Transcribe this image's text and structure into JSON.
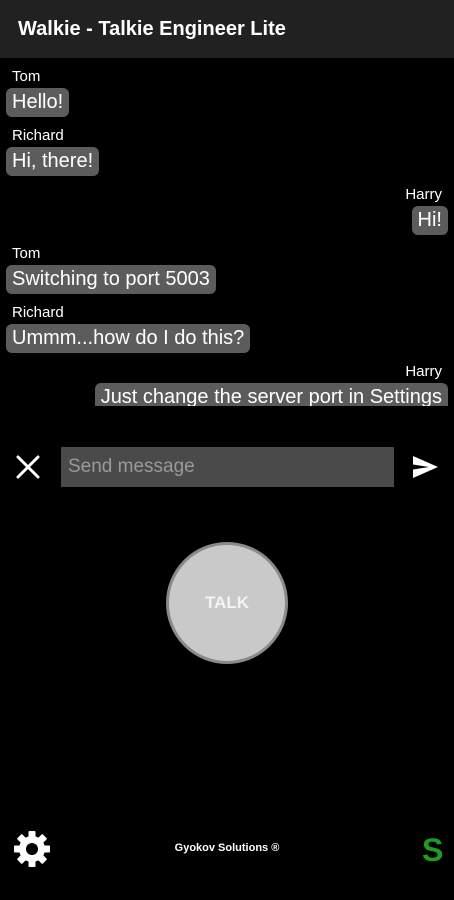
{
  "app": {
    "title": "Walkie - Talkie Engineer Lite"
  },
  "messages": [
    {
      "sender": "Tom",
      "text": "Hello!",
      "side": "left"
    },
    {
      "sender": "Richard",
      "text": "Hi, there!",
      "side": "left"
    },
    {
      "sender": "Harry",
      "text": "Hi!",
      "side": "right"
    },
    {
      "sender": "Tom",
      "text": "Switching to port 5003",
      "side": "left"
    },
    {
      "sender": "Richard",
      "text": "Ummm...how do I do this?",
      "side": "left"
    },
    {
      "sender": "Harry",
      "text": "Just change the server port in Settings",
      "side": "right"
    }
  ],
  "input": {
    "placeholder": "Send message",
    "value": ""
  },
  "talk": {
    "label": "TALK"
  },
  "footer": {
    "brand": "Gyokov Solutions ®",
    "status_letter": "S",
    "status_color": "#1e9e1e"
  },
  "icons": {
    "clear": "close-icon",
    "send": "send-icon",
    "settings": "gear-icon"
  },
  "colors": {
    "background": "#000000",
    "app_bar": "#212121",
    "bubble": "#5c5c5c",
    "input_bg": "#4a4a4a",
    "talk_button": "#c9c9c9"
  }
}
